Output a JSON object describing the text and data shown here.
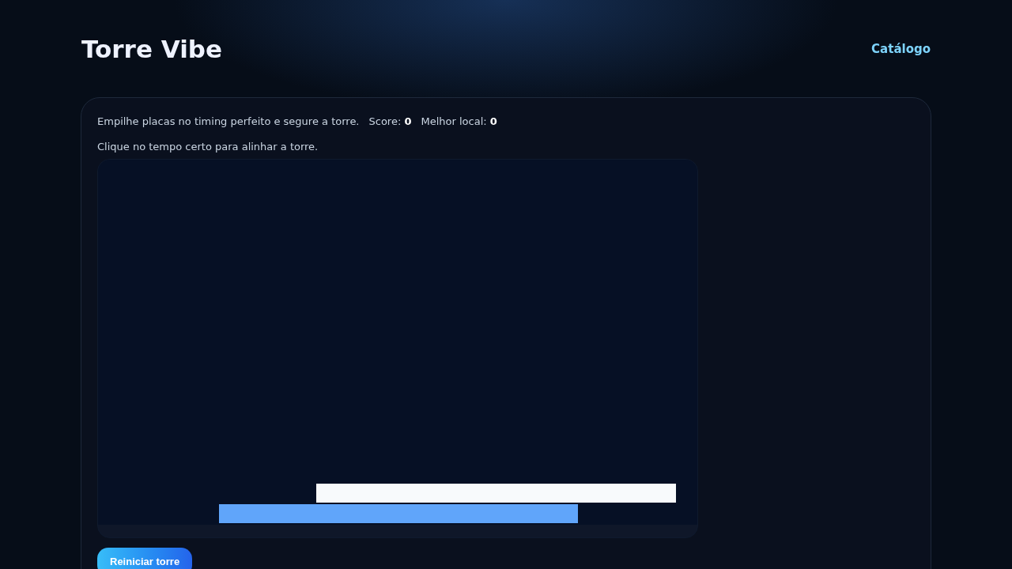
{
  "header": {
    "title": "Torre Vibe",
    "nav_link": "Catálogo"
  },
  "card": {
    "description": "Empilhe placas no timing perfeito e segure a torre.",
    "score_label": "Score:",
    "score": "0",
    "best_label": "Melhor local:",
    "best": "0",
    "hint": "Clique no tempo certo para alinhar a torre.",
    "blocks": [
      {
        "color": "#f8fafc"
      },
      {
        "color": "#60a5fa"
      }
    ],
    "button": "Reiniciar torre"
  }
}
